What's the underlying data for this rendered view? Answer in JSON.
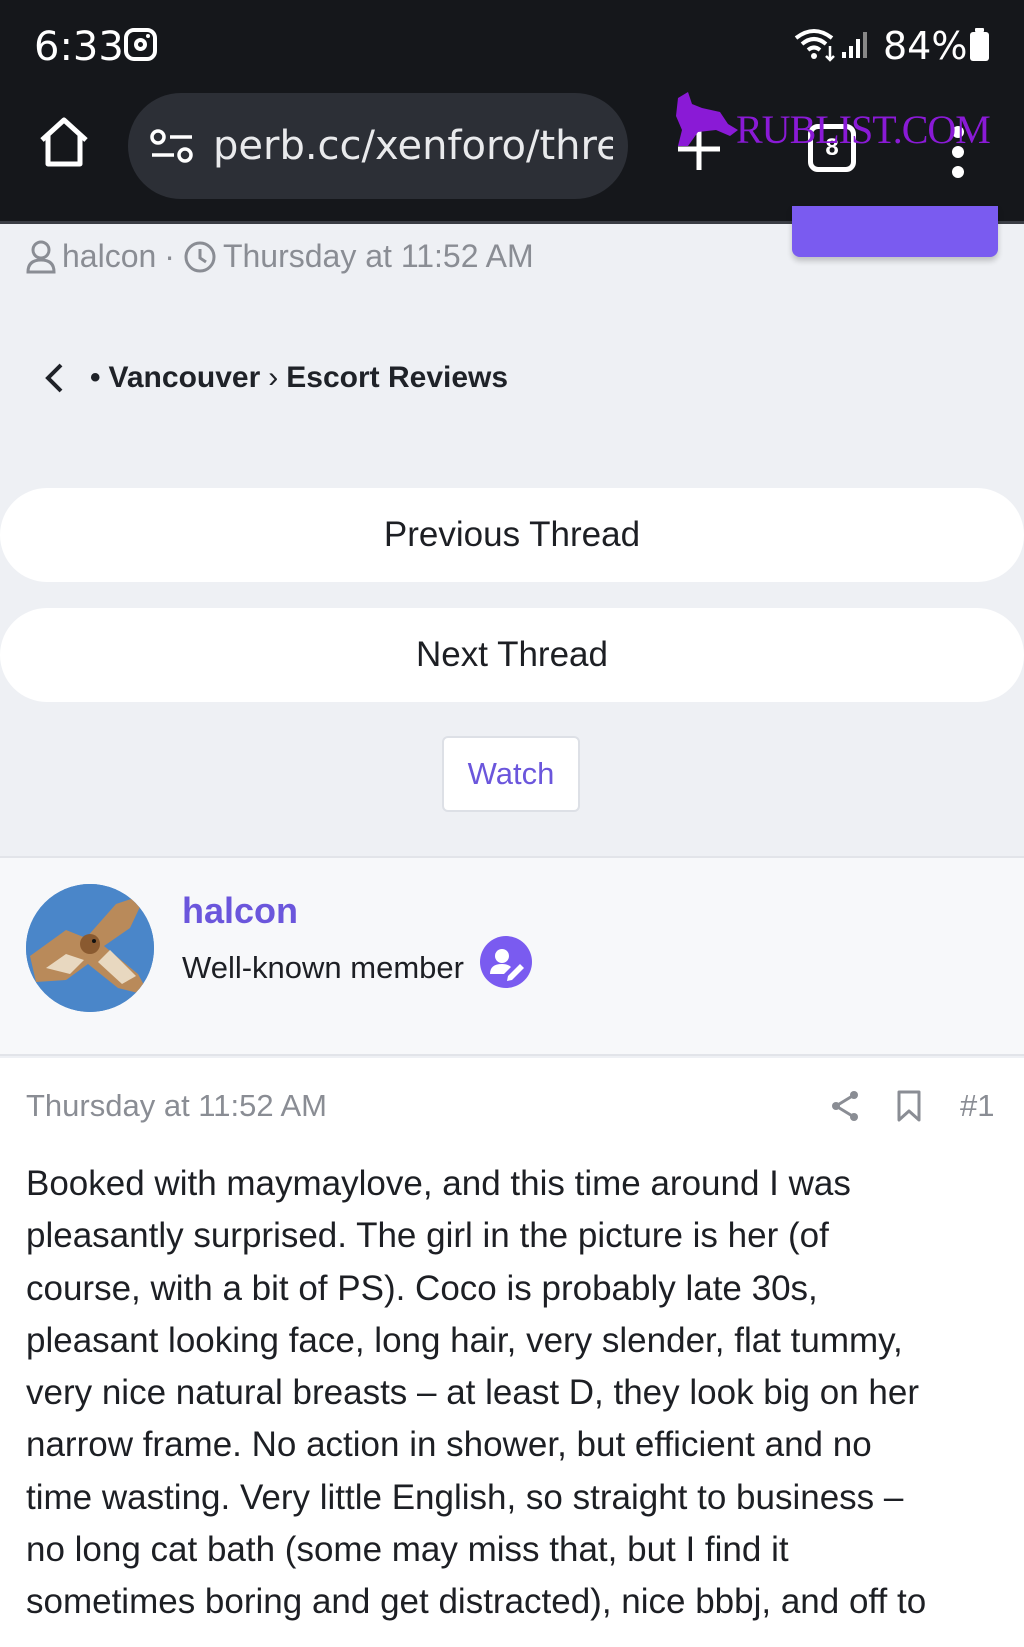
{
  "status_bar": {
    "time": "6:33",
    "battery": "84%"
  },
  "browser": {
    "url": "perb.cc/xenforo/thre",
    "tab_count": "8"
  },
  "watermark": {
    "text": "RUBLIST.COM"
  },
  "thread_meta": {
    "author": "halcon",
    "separator": "·",
    "date": "Thursday at 11:52 AM"
  },
  "breadcrumb": {
    "bullet": "•",
    "items": [
      "Vancouver",
      "Escort Reviews"
    ],
    "separator": "›"
  },
  "nav": {
    "previous_label": "Previous Thread",
    "next_label": "Next Thread",
    "watch_label": "Watch"
  },
  "post": {
    "username": "halcon",
    "user_title": "Well-known member",
    "date": "Thursday at 11:52 AM",
    "number": "#1",
    "body_lines": [
      "Booked with maymaylove, and this time around I was",
      "pleasantly surprised. The girl in the picture is her (of",
      "course, with a bit of PS). Coco is probably late 30s,",
      "pleasant looking face, long hair, very slender, flat tummy,",
      "very nice natural breasts – at least D, they look big on her",
      "narrow frame. No action in shower, but efficient and no",
      "time wasting. Very little English, so straight to business –",
      "no long cat bath (some may miss that, but I find it",
      "sometimes boring and get distracted), nice bbbj, and off to"
    ]
  },
  "colors": {
    "accent": "#6b56dc",
    "button": "#7a5bf0",
    "background": "#eef0f4",
    "chrome": "#15171b"
  }
}
